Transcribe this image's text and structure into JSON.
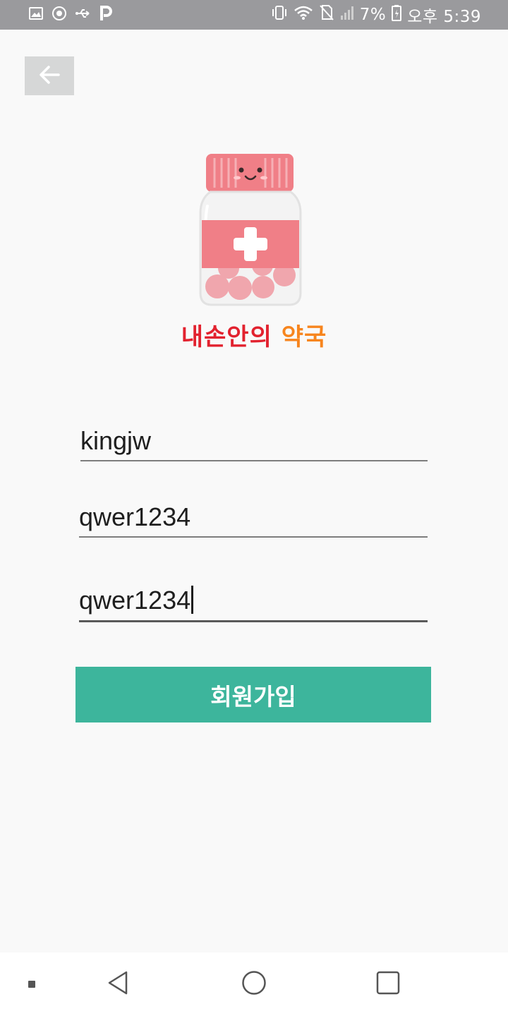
{
  "status_bar": {
    "battery_percent": "7%",
    "time": "오후 5:39",
    "left_icons": [
      "gallery-icon",
      "sync-icon",
      "usb-icon",
      "parking-app-icon"
    ],
    "right_icons": [
      "vibrate-icon",
      "wifi-icon",
      "no-sim-icon",
      "signal-icon",
      "battery-icon"
    ]
  },
  "header": {
    "back_icon": "arrow-left-icon"
  },
  "logo": {
    "title_part1": "내손안의",
    "title_part2": "약국",
    "colors": {
      "title_red": "#e2222f",
      "title_orange": "#f7851e",
      "bottle_pink": "#f07f87"
    }
  },
  "form": {
    "username": "kingjw",
    "password": "qwer1234",
    "password_confirm": "qwer1234"
  },
  "signup_button": {
    "label": "회원가입",
    "color": "#3db59c"
  },
  "nav": {
    "items": [
      "dot-icon",
      "back-triangle-icon",
      "home-circle-icon",
      "recents-square-icon"
    ]
  }
}
